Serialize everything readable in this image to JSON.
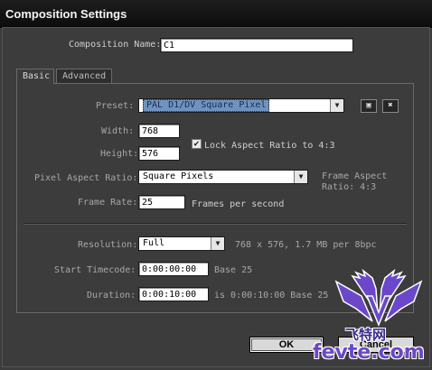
{
  "window": {
    "title": "Composition Settings"
  },
  "composition_name": {
    "label": "Composition Name:",
    "value": "C1"
  },
  "tabs": [
    {
      "label": "Basic",
      "active": true
    },
    {
      "label": "Advanced",
      "active": false
    }
  ],
  "preset": {
    "label": "Preset:",
    "value": "PAL D1/DV Square Pixel"
  },
  "width": {
    "label": "Width:",
    "value": "768"
  },
  "height": {
    "label": "Height:",
    "value": "576"
  },
  "lock_aspect": {
    "label": "Lock Aspect Ratio to 4:3",
    "checked": true
  },
  "pixel_aspect": {
    "label": "Pixel Aspect Ratio:",
    "value": "Square Pixels",
    "frame_aspect_line1": "Frame Aspect",
    "frame_aspect_line2": "Ratio: 4:3"
  },
  "frame_rate": {
    "label": "Frame Rate:",
    "value": "25",
    "suffix": "Frames per second"
  },
  "resolution": {
    "label": "Resolution:",
    "value": "Full",
    "info": "768 x 576, 1.7 MB per 8bpc"
  },
  "start_timecode": {
    "label": "Start Timecode:",
    "value": "0:00:00:00",
    "suffix": "Base 25"
  },
  "duration": {
    "label": "Duration:",
    "value": "0:00:10:00",
    "suffix": "is 0:00:10:00  Base 25"
  },
  "buttons": {
    "ok": "OK",
    "cancel": "Cancel"
  },
  "watermark": {
    "line1": "飞特网",
    "line2": "fevte.com"
  },
  "colors": {
    "titlebar": "#101010",
    "background": "#3c3c3c",
    "selection": "#6f93bf",
    "logo_purple": "#6a48c9"
  },
  "icons": [
    "save-preset-icon",
    "delete-preset-icon",
    "dropdown-arrow-icon",
    "checkmark-icon"
  ]
}
